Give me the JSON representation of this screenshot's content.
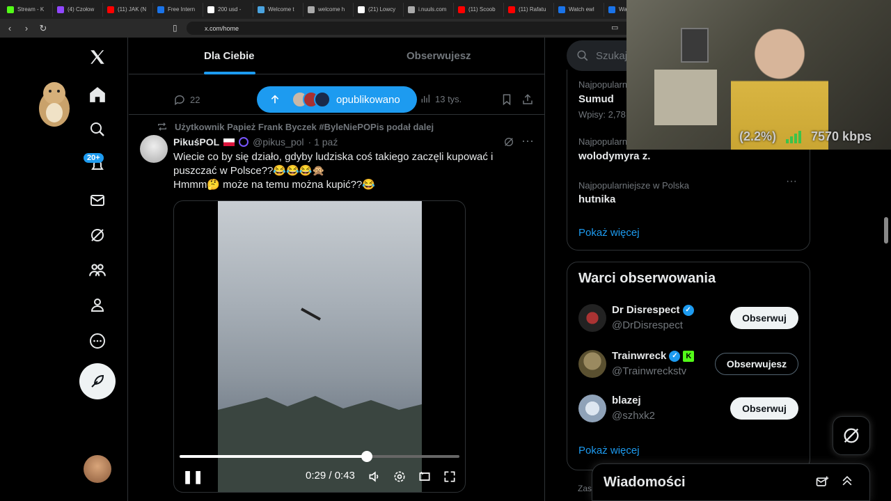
{
  "browser": {
    "tabs": [
      {
        "label": "Stream - K",
        "color": "#53fc18"
      },
      {
        "label": "(4) Czołow",
        "color": "#9147ff"
      },
      {
        "label": "(11) JAK (N",
        "color": "#ff0000"
      },
      {
        "label": "Free Intern",
        "color": "#1a73e8"
      },
      {
        "label": "200 usd -",
        "color": "#ffffff"
      },
      {
        "label": "Welcome t",
        "color": "#4aa3df"
      },
      {
        "label": "welcome h",
        "color": "#aaaaaa"
      },
      {
        "label": "(21) Lowcy",
        "color": "#ffffff"
      },
      {
        "label": "i.nuuls.com",
        "color": "#aaaaaa"
      },
      {
        "label": "(11) Scoob",
        "color": "#ff0000"
      },
      {
        "label": "(11) Rafatu",
        "color": "#ff0000"
      },
      {
        "label": "Watch ewl",
        "color": "#1a73e8"
      },
      {
        "label": "Watc",
        "color": "#1a73e8"
      }
    ],
    "url": "x.com/home"
  },
  "sidebar": {
    "notifications_badge": "20+",
    "items": [
      "home-icon",
      "search-icon",
      "bell-icon",
      "mail-icon",
      "grok-icon",
      "communities-icon",
      "profile-icon",
      "more-icon"
    ]
  },
  "feed": {
    "tabs": [
      {
        "label": "Dla Ciebie",
        "active": true
      },
      {
        "label": "Obserwujesz",
        "active": false
      }
    ],
    "prev_post": {
      "replies": "22",
      "views": "13 tys."
    },
    "new_posts_label": "opublikowano",
    "post": {
      "repost_label": "Użytkownik Papież Frank Byczek #ByleNiePOPis podał dalej",
      "name": "PikuśPOL",
      "handle": "@pikus_pol",
      "time": "· 1 paź",
      "text_lines": [
        "Wiecie co by się działo, gdyby ludziska coś takiego zaczęli kupować i",
        "puszczać w Polsce??😂😂😂🙊",
        "Hmmm🤔 może na temu można kupić??😂"
      ],
      "video": {
        "time": "0:29 / 0:43",
        "progress": 0.67
      }
    }
  },
  "right": {
    "search_placeholder": "Szukaj",
    "trends": [
      {
        "context": "Najpopularn",
        "name": "Sumud",
        "posts": "Wpisy: 2,78"
      },
      {
        "context": "Najpopularn",
        "name": "wolodymyra z.",
        "posts": ""
      },
      {
        "context": "Najpopularniejsze w Polska",
        "name": "hutnika",
        "posts": ""
      }
    ],
    "show_more": "Pokaż więcej",
    "who_to_follow": {
      "title": "Warci obserwowania",
      "accounts": [
        {
          "name": "Dr Disrespect",
          "handle": "@DrDisrespect",
          "button": "Obserwuj",
          "following": false
        },
        {
          "name": "Trainwreck",
          "handle": "@Trainwreckstv",
          "button": "Obserwujesz",
          "following": true
        },
        {
          "name": "blazej",
          "handle": "@szhxk2",
          "button": "Obserwuj",
          "following": false
        }
      ],
      "show_more": "Pokaż więcej"
    },
    "footer_partial": "Zas"
  },
  "messages": {
    "title": "Wiadomości"
  },
  "overlay": {
    "percent": "(2.2%)",
    "bitrate": "7570 kbps"
  }
}
